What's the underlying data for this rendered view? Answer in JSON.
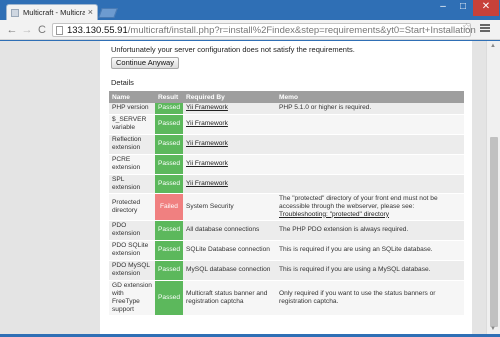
{
  "browser": {
    "tab_title": "Multicraft - Multicraft I",
    "tab_close": "×",
    "url_host": "133.130.55.91",
    "url_rest": "/multicraft/install.php?r=install%2Findex&step=requirements&yt0=Start+Installation",
    "back": "←",
    "forward": "→",
    "reload": "C",
    "star": "☆",
    "minimize": "–",
    "maximize": "□",
    "close": "✕"
  },
  "page": {
    "message": "Unfortunately your server configuration does not satisfy the requirements.",
    "continue_label": "Continue Anyway",
    "details_label": "Details"
  },
  "table": {
    "headers": [
      "Name",
      "Result",
      "Required By",
      "Memo"
    ],
    "rows": [
      {
        "name": "PHP version",
        "result": "Passed",
        "required_by": "Yii Framework",
        "required_by_link": true,
        "memo": "PHP 5.1.0 or higher is required."
      },
      {
        "name": "$_SERVER variable",
        "result": "Passed",
        "required_by": "Yii Framework",
        "required_by_link": true,
        "memo": ""
      },
      {
        "name": "Reflection extension",
        "result": "Passed",
        "required_by": "Yii Framework",
        "required_by_link": true,
        "memo": ""
      },
      {
        "name": "PCRE extension",
        "result": "Passed",
        "required_by": "Yii Framework",
        "required_by_link": true,
        "memo": ""
      },
      {
        "name": "SPL extension",
        "result": "Passed",
        "required_by": "Yii Framework",
        "required_by_link": true,
        "memo": ""
      },
      {
        "name": "Protected directory",
        "result": "Failed",
        "required_by": "System Security",
        "required_by_link": false,
        "memo": "The \"protected\" directory of your front end must not be accessible through the webserver, please see:",
        "memo_link": "Troubleshooting: \"protected\" directory"
      },
      {
        "name": "PDO extension",
        "result": "Passed",
        "required_by": "All database connections",
        "required_by_link": false,
        "memo": "The PHP PDO extension is always required."
      },
      {
        "name": "PDO SQLite extension",
        "result": "Passed",
        "required_by": "SQLite Database connection",
        "required_by_link": false,
        "memo": "This is required if you are using an SQLite database."
      },
      {
        "name": "PDO MySQL extension",
        "result": "Passed",
        "required_by": "MySQL database connection",
        "required_by_link": false,
        "memo": "This is required if you are using a MySQL database."
      },
      {
        "name": "GD extension with FreeType support",
        "result": "Passed",
        "required_by": "Multicraft status banner and registration captcha",
        "required_by_link": false,
        "memo": "Only required if you want to use the status banners or registration captcha."
      }
    ]
  },
  "colors": {
    "passed": "#5cb85c",
    "failed": "#f08080",
    "header": "#9e9e9e",
    "window_frame": "#2f6fb5"
  }
}
